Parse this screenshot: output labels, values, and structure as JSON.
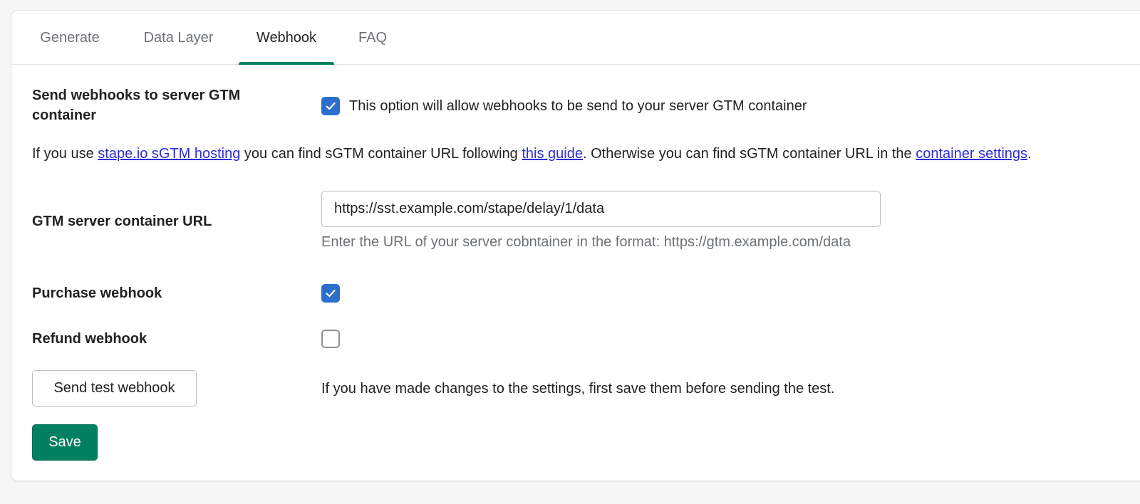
{
  "tabs": [
    {
      "label": "Generate",
      "active": false
    },
    {
      "label": "Data Layer",
      "active": false
    },
    {
      "label": "Webhook",
      "active": true
    },
    {
      "label": "FAQ",
      "active": false
    }
  ],
  "send_webhooks": {
    "label": "Send webhooks to server GTM container",
    "checked": true,
    "description": "This option will allow webhooks to be send to your server GTM container"
  },
  "info": {
    "part1": "If you use ",
    "link1": "stape.io sGTM hosting",
    "part2": " you can find sGTM container URL following ",
    "link2": "this guide",
    "part3": ". Otherwise you can find sGTM container URL in the ",
    "link3": "container settings",
    "part4": "."
  },
  "gtm_url": {
    "label": "GTM server container URL",
    "value": "https://sst.example.com/stape/delay/1/data",
    "help": "Enter the URL of your server cobntainer in the format: https://gtm.example.com/data"
  },
  "purchase_webhook": {
    "label": "Purchase webhook",
    "checked": true
  },
  "refund_webhook": {
    "label": "Refund webhook",
    "checked": false
  },
  "test": {
    "button_label": "Send test webhook",
    "note": "If you have made changes to the settings, first save them before sending the test."
  },
  "save_label": "Save",
  "colors": {
    "primary": "#008060",
    "checkbox": "#2c6ecb",
    "link": "#2c2cd8"
  }
}
